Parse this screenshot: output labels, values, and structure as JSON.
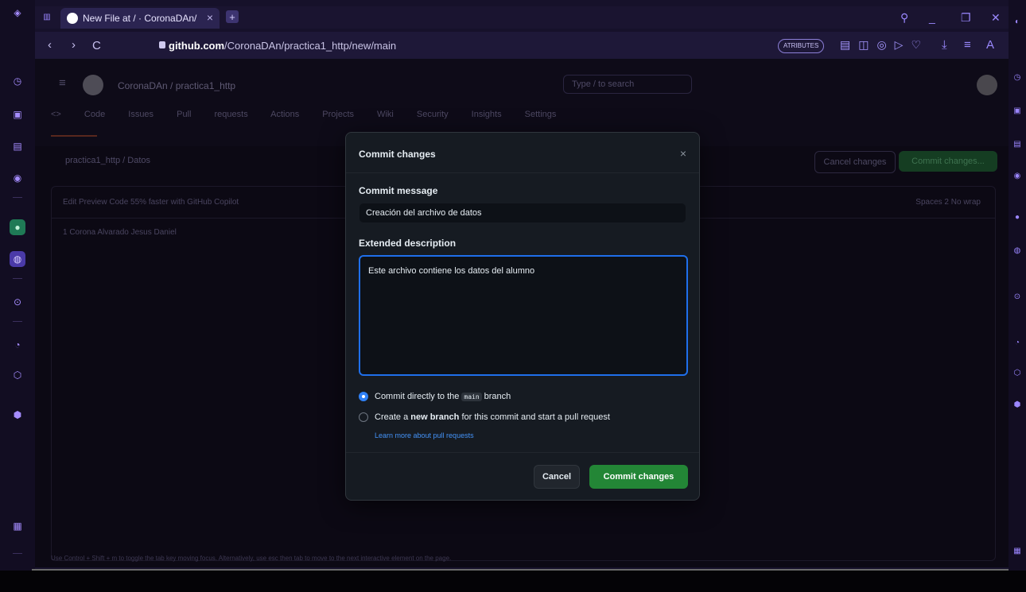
{
  "browser": {
    "tab_title": "New File at / · CoronaDAn/",
    "url_domain": "github.com",
    "url_path": "/CoronaDAn/practica1_http/new/main",
    "reader_badge": "ATRIBUTES"
  },
  "github": {
    "repo": "CoronaDAn / practica1_http",
    "search_placeholder": "Type / to search",
    "tabs": "<> Code  Issues  Pull requests  Actions  Projects  Wiki  Security  Insights  Settings",
    "path": "practica1_http / Datos",
    "cancel_label": "Cancel changes",
    "commit_label": "Commit changes...",
    "file_toolbar": "Edit   Preview   Code 55% faster with GitHub Copilot",
    "file_options": "Spaces  2  No wrap",
    "code_line": "1   Corona Alvarado Jesus Daniel",
    "footer": "Use Control + Shift + m to toggle the tab key moving focus. Alternatively, use esc then tab to move to the next interactive element on the page."
  },
  "modal": {
    "title": "Commit changes",
    "close": "×",
    "commit_message_label": "Commit message",
    "commit_message_value": "Creación del archivo de datos",
    "extended_label": "Extended description",
    "extended_value": "Este archivo contiene los datos del alumno",
    "option_direct_pre": "Commit directly to the",
    "option_direct_branch": "main",
    "option_direct_post": "branch",
    "option_new_pre": "Create a",
    "option_new_bold": "new branch",
    "option_new_post": "for this commit and start a pull request",
    "learn_more": "Learn more about pull requests",
    "cancel": "Cancel",
    "commit": "Commit changes"
  }
}
